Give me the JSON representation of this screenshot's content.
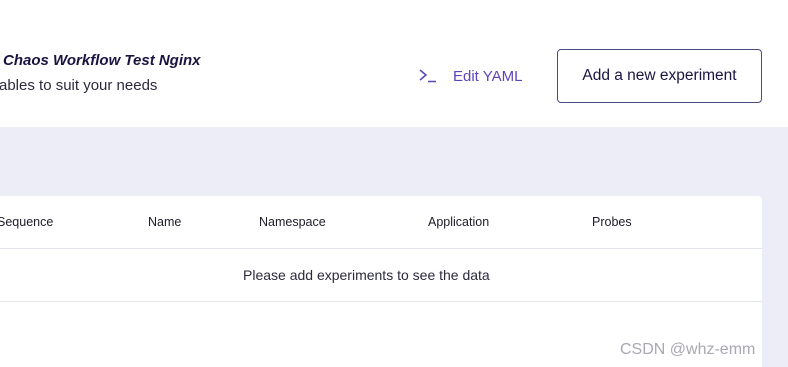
{
  "header": {
    "title": "Chaos Workflow Test Nginx",
    "subtitle": "ables to suit your needs",
    "edit_yaml_label": "Edit YAML",
    "edit_yaml_icon": "terminal-icon",
    "add_experiment_label": "Add a new experiment"
  },
  "table": {
    "columns": [
      "Sequence",
      "Name",
      "Namespace",
      "Application",
      "Probes"
    ],
    "empty_message": "Please add experiments to see the data"
  },
  "watermark": "CSDN @whz-emm",
  "colors": {
    "accent": "#5b44ba",
    "page_background": "#ecedf7",
    "button_border": "#4d4a82"
  }
}
